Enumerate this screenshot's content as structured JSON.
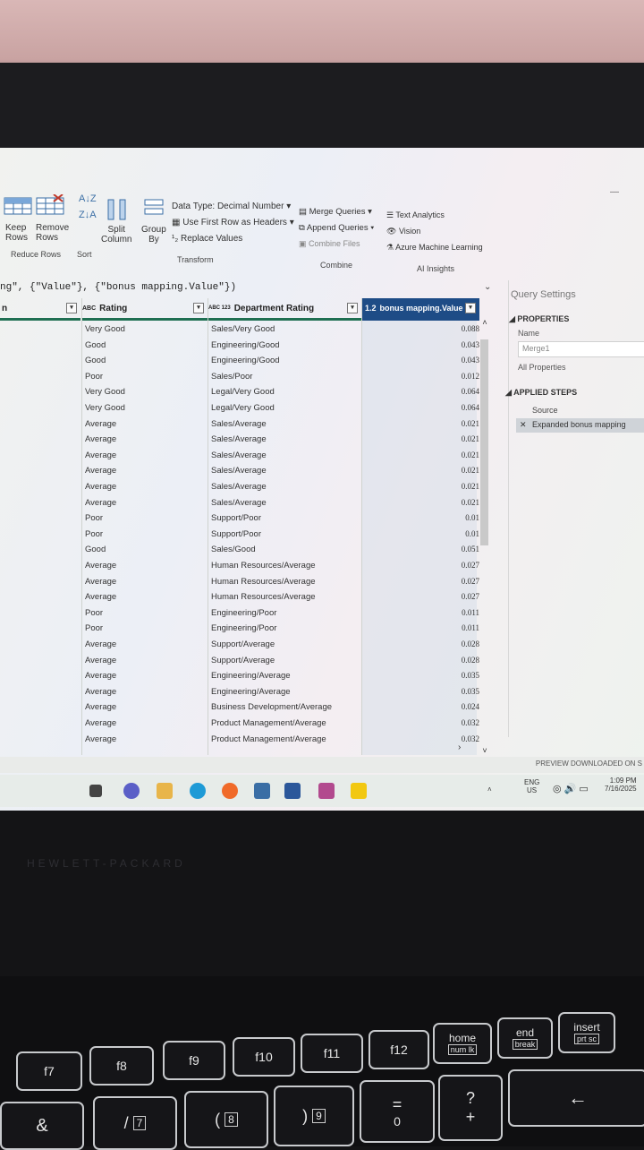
{
  "ribbon": {
    "keep_rows": "Keep\nRows",
    "remove_rows": "Remove\nRows",
    "reduce_rows_group": "Reduce Rows",
    "sort_group": "Sort",
    "split_column": "Split\nColumn",
    "group_by": "Group\nBy",
    "data_type": "Data Type: Decimal Number",
    "use_first_row": "Use First Row as Headers",
    "replace_values": "Replace Values",
    "transform_group": "Transform",
    "merge_queries": "Merge Queries",
    "append_queries": "Append Queries",
    "combine_files": "Combine Files",
    "combine_group": "Combine",
    "text_analytics": "Text Analytics",
    "vision": "Vision",
    "azure_ml": "Azure Machine Learning",
    "ai_group": "AI Insights"
  },
  "formula": "ng\", {\"Value\"}, {\"bonus mapping.Value\"})",
  "columns": {
    "col0": "n",
    "rating": "Rating",
    "department_rating": "Department Rating",
    "bonus_value": "bonus mapping.Value",
    "rating_type": "ABC",
    "dept_type": "ABC 123",
    "bonus_type": "1.2"
  },
  "rows": [
    {
      "rating": "Very Good",
      "dept": "Sales/Very Good",
      "value": "0.088"
    },
    {
      "rating": "Good",
      "dept": "Engineering/Good",
      "value": "0.043"
    },
    {
      "rating": "Good",
      "dept": "Engineering/Good",
      "value": "0.043"
    },
    {
      "rating": "Poor",
      "dept": "Sales/Poor",
      "value": "0.012"
    },
    {
      "rating": "Very Good",
      "dept": "Legal/Very Good",
      "value": "0.064"
    },
    {
      "rating": "Very Good",
      "dept": "Legal/Very Good",
      "value": "0.064"
    },
    {
      "rating": "Average",
      "dept": "Sales/Average",
      "value": "0.021"
    },
    {
      "rating": "Average",
      "dept": "Sales/Average",
      "value": "0.021"
    },
    {
      "rating": "Average",
      "dept": "Sales/Average",
      "value": "0.021"
    },
    {
      "rating": "Average",
      "dept": "Sales/Average",
      "value": "0.021"
    },
    {
      "rating": "Average",
      "dept": "Sales/Average",
      "value": "0.021"
    },
    {
      "rating": "Average",
      "dept": "Sales/Average",
      "value": "0.021"
    },
    {
      "rating": "Poor",
      "dept": "Support/Poor",
      "value": "0.01"
    },
    {
      "rating": "Poor",
      "dept": "Support/Poor",
      "value": "0.01"
    },
    {
      "rating": "Good",
      "dept": "Sales/Good",
      "value": "0.051"
    },
    {
      "rating": "Average",
      "dept": "Human Resources/Average",
      "value": "0.027"
    },
    {
      "rating": "Average",
      "dept": "Human Resources/Average",
      "value": "0.027"
    },
    {
      "rating": "Average",
      "dept": "Human Resources/Average",
      "value": "0.027"
    },
    {
      "rating": "Poor",
      "dept": "Engineering/Poor",
      "value": "0.011"
    },
    {
      "rating": "Poor",
      "dept": "Engineering/Poor",
      "value": "0.011"
    },
    {
      "rating": "Average",
      "dept": "Support/Average",
      "value": "0.028"
    },
    {
      "rating": "Average",
      "dept": "Support/Average",
      "value": "0.028"
    },
    {
      "rating": "Average",
      "dept": "Engineering/Average",
      "value": "0.035"
    },
    {
      "rating": "Average",
      "dept": "Engineering/Average",
      "value": "0.035"
    },
    {
      "rating": "Average",
      "dept": "Business Development/Average",
      "value": "0.024"
    },
    {
      "rating": "Average",
      "dept": "Product Management/Average",
      "value": "0.032"
    },
    {
      "rating": "Average",
      "dept": "Product Management/Average",
      "value": "0.032"
    }
  ],
  "query_settings": {
    "title": "Query Settings",
    "properties": "PROPERTIES",
    "name_label": "Name",
    "name_value": "Merge1",
    "all_properties": "All Properties",
    "applied_steps": "APPLIED STEPS",
    "steps": [
      "Source",
      "Expanded bonus mapping"
    ]
  },
  "status": {
    "preview": "PREVIEW DOWNLOADED ON S"
  },
  "tray": {
    "lang": "ENG",
    "region": "US",
    "time": "1:09 PM",
    "date": "7/16/2025"
  },
  "laptop": {
    "brand": "HEWLETT-PACKARD"
  },
  "keys": {
    "f7": "f7",
    "f8": "f8",
    "f9": "f9",
    "f10": "f10",
    "f11": "f11",
    "f12": "f12",
    "home": "home",
    "numlk": "num lk",
    "end": "end",
    "break": "break",
    "insert": "insert",
    "prtsc": "prt sc",
    "ampersand": "&",
    "seven": "7",
    "slash": "/",
    "eight": "8",
    "lparen": "(",
    "nine": "9",
    "rparen": ")",
    "zero": "0",
    "equals": "=",
    "question": "?",
    "plus": "+",
    "backspace": "←"
  },
  "colors": {
    "header_selected": "#1e4c86",
    "header_underline": "#1f6f52"
  }
}
